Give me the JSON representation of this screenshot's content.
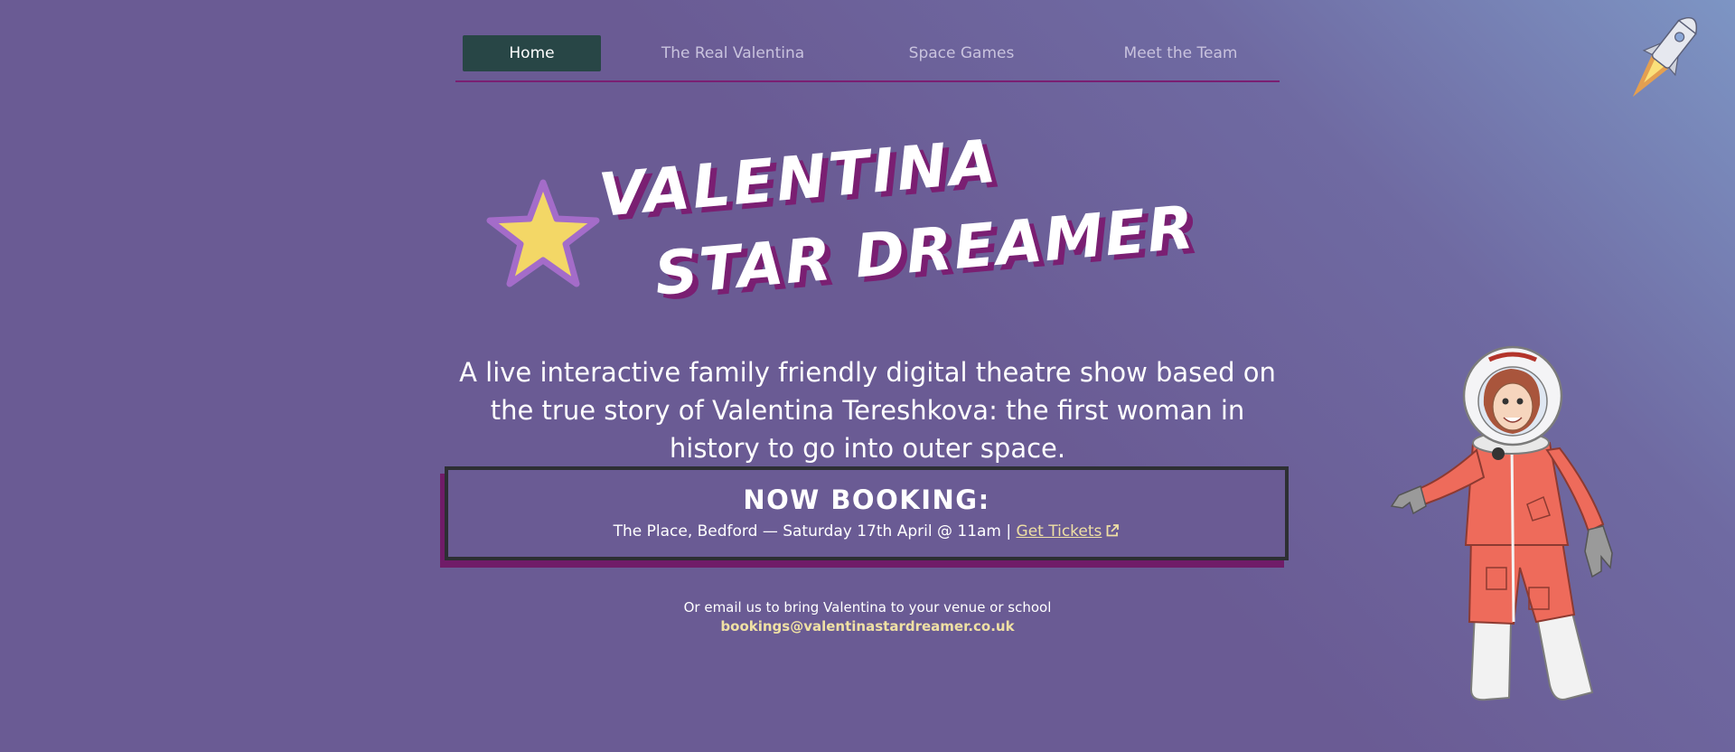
{
  "nav": {
    "items": [
      {
        "label": "Home",
        "active": true
      },
      {
        "label": "The Real Valentina",
        "active": false
      },
      {
        "label": "Space Games",
        "active": false
      },
      {
        "label": "Meet the Team",
        "active": false
      }
    ]
  },
  "hero": {
    "title_line1": "VALENTINA",
    "title_line2": "STAR DREAMER",
    "tagline": "A live interactive family friendly digital theatre show based on the true story of Valentina Tereshkova: the first woman in history to go into outer space."
  },
  "booking": {
    "heading": "NOW BOOKING:",
    "details": "The Place, Bedford — Saturday 17th April @ 11am | ",
    "tickets_label": "Get Tickets"
  },
  "contact": {
    "note": "Or email us to bring Valentina to your venue or school",
    "email": "bookings@valentinastardreamer.co.uk"
  },
  "colors": {
    "background": "#6a5b94",
    "nav_active_bg": "#284646",
    "accent_purple": "#7a1f72",
    "link_yellow": "#efe0a4",
    "star_yellow": "#f3d766",
    "star_border": "#a46cc9"
  },
  "icons": {
    "logo": "star-icon",
    "tickets": "external-link-icon",
    "decoration_top": "rocket-icon",
    "decoration_side": "astronaut-illustration"
  }
}
